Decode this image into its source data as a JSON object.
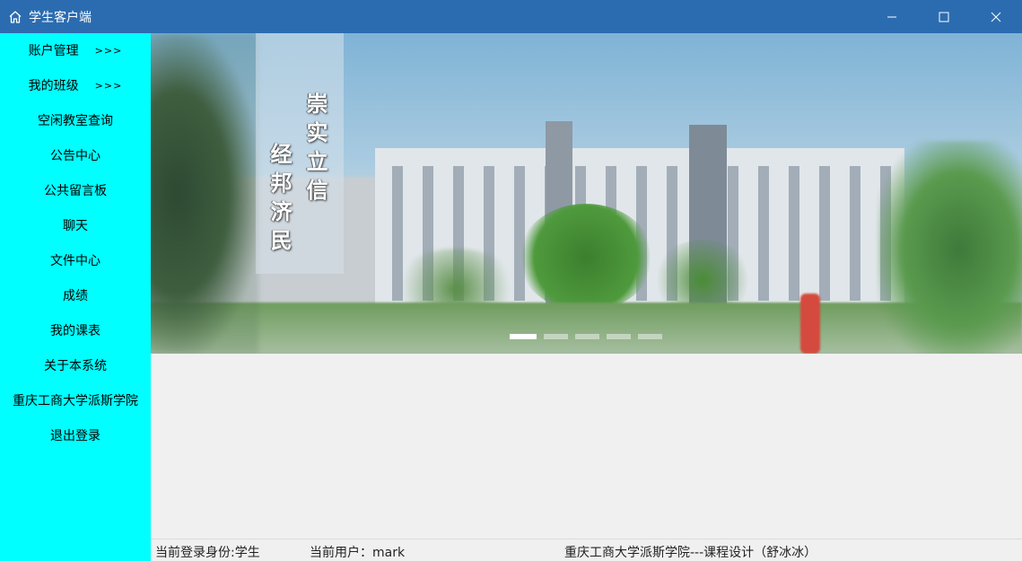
{
  "window": {
    "title": "学生客户端",
    "title_icon": "home-icon",
    "titlebar_color": "#2b6cb0"
  },
  "sidebar": {
    "background": "#00ffff",
    "items": [
      {
        "label": "账户管理",
        "suffix": ">>>"
      },
      {
        "label": "我的班级",
        "suffix": ">>>"
      },
      {
        "label": "空闲教室查询"
      },
      {
        "label": "公告中心"
      },
      {
        "label": "公共留言板"
      },
      {
        "label": "聊天"
      },
      {
        "label": "文件中心"
      },
      {
        "label": "成绩"
      },
      {
        "label": "我的课表"
      },
      {
        "label": "关于本系统"
      },
      {
        "label": "重庆工商大学派斯学院"
      },
      {
        "label": "退出登录"
      }
    ]
  },
  "banner": {
    "calligraphy": {
      "col1": "崇实立信",
      "col2": "经邦济民"
    },
    "slide_count": 5,
    "active_slide": 1
  },
  "status": {
    "role": "当前登录身份:学生",
    "user": "当前用户：mark",
    "course": "重庆工商大学派斯学院---课程设计（舒冰冰）"
  }
}
